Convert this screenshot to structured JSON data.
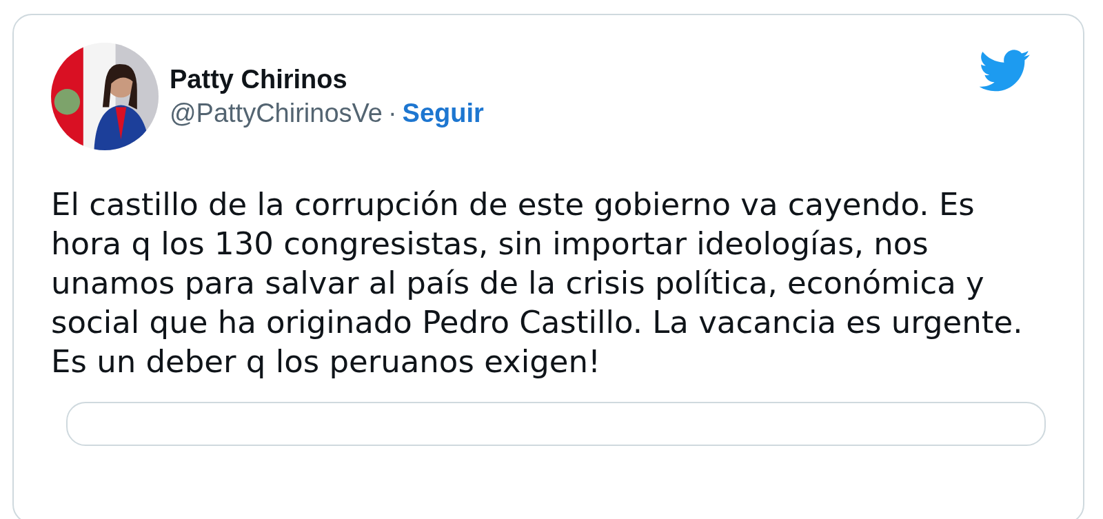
{
  "tweet": {
    "author_name": "Patty Chirinos",
    "handle": "@PattyChirinosVe",
    "separator": "·",
    "follow_label": "Seguir",
    "text": "El castillo de la corrupción de este gobierno va cayendo. Es hora q los 130 congresistas, sin importar ideologías, nos unamos para salvar al país de la crisis política, económica y social que ha originado Pedro Castillo. La vacancia es urgente. Es un deber q los peruanos exigen!"
  }
}
